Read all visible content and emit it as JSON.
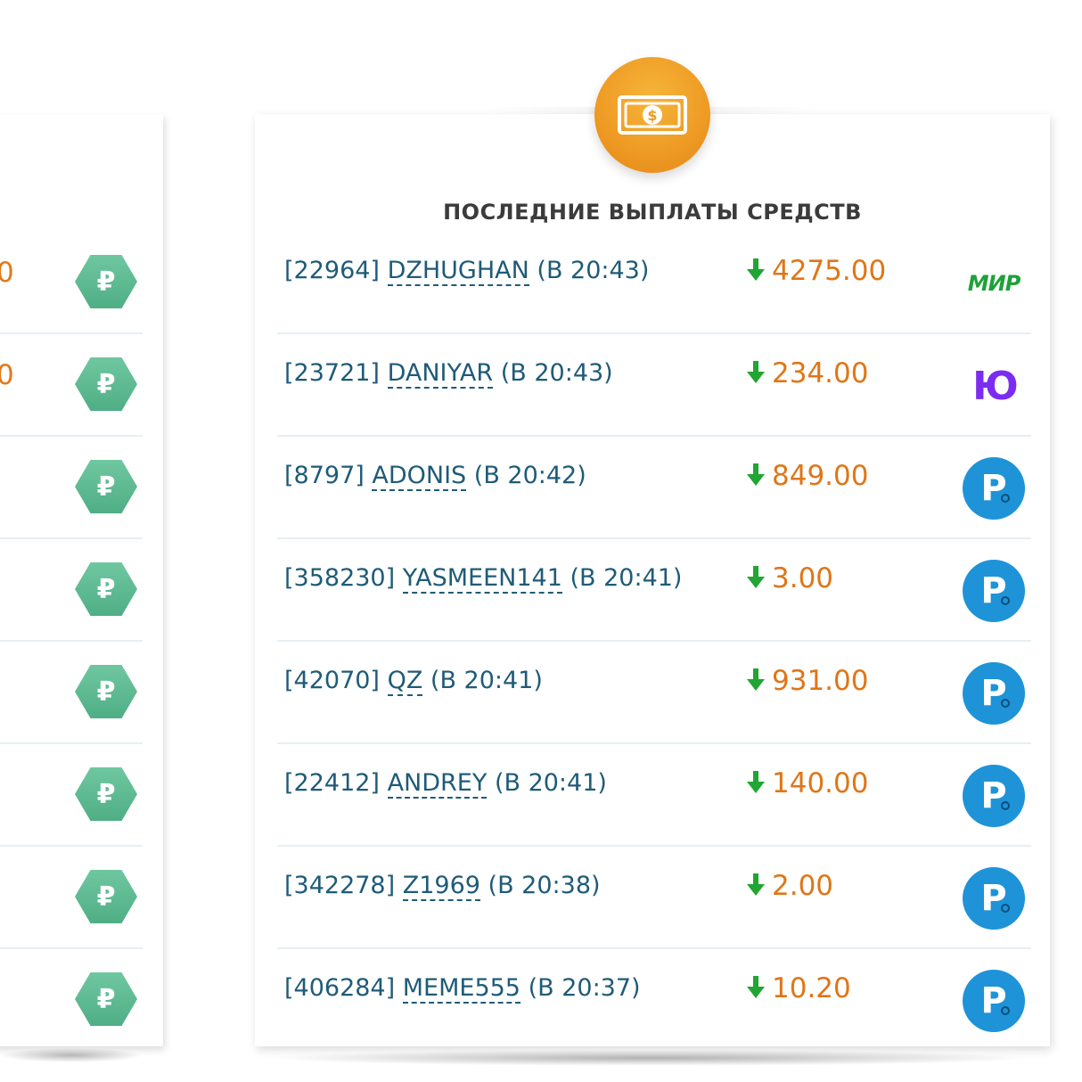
{
  "left_panel": {
    "rows": [
      {
        "amount": "0"
      },
      {
        "amount": "0"
      },
      {
        "amount": ""
      },
      {
        "amount": ""
      },
      {
        "amount": ""
      },
      {
        "amount": ""
      },
      {
        "amount": ""
      },
      {
        "amount": ""
      }
    ],
    "currency_symbol": "₽"
  },
  "payouts": {
    "title": "ПОСЛЕДНИЕ ВЫПЛАТЫ СРЕДСТВ",
    "rows": [
      {
        "id": "[22964]",
        "user": "DZHUGHAN",
        "time": "(В 20:43)",
        "amount": "4275.00",
        "method": "mir",
        "method_label": "МИР"
      },
      {
        "id": "[23721]",
        "user": "DANIYAR",
        "time": "(В 20:43)",
        "amount": "234.00",
        "method": "yoomoney",
        "method_label": "Ю"
      },
      {
        "id": "[8797]",
        "user": "ADONIS",
        "time": "(В 20:42)",
        "amount": "849.00",
        "method": "payeer",
        "method_label": "P"
      },
      {
        "id": "[358230]",
        "user": "YASMEEN141",
        "time": "(В 20:41)",
        "amount": "3.00",
        "method": "payeer",
        "method_label": "P"
      },
      {
        "id": "[42070]",
        "user": "QZ",
        "time": "(В 20:41)",
        "amount": "931.00",
        "method": "payeer",
        "method_label": "P"
      },
      {
        "id": "[22412]",
        "user": "ANDREY",
        "time": "(В 20:41)",
        "amount": "140.00",
        "method": "payeer",
        "method_label": "P"
      },
      {
        "id": "[342278]",
        "user": "Z1969",
        "time": "(В 20:38)",
        "amount": "2.00",
        "method": "payeer",
        "method_label": "P"
      },
      {
        "id": "[406284]",
        "user": "MEME555",
        "time": "(В 20:37)",
        "amount": "10.20",
        "method": "payeer",
        "method_label": "P"
      }
    ]
  },
  "icons": {
    "header": "money-bill-icon",
    "arrow": "arrow-down-icon",
    "left_badge": "ruble-hexagon-icon"
  },
  "colors": {
    "coin": "#ee9a23",
    "amount": "#df7618",
    "arrow": "#21a533",
    "text": "#1f5b78",
    "payeer": "#1e93d8",
    "mir": "#1fa13a",
    "yoomoney": "#7b2cf0",
    "hex": "#5bb98f"
  }
}
